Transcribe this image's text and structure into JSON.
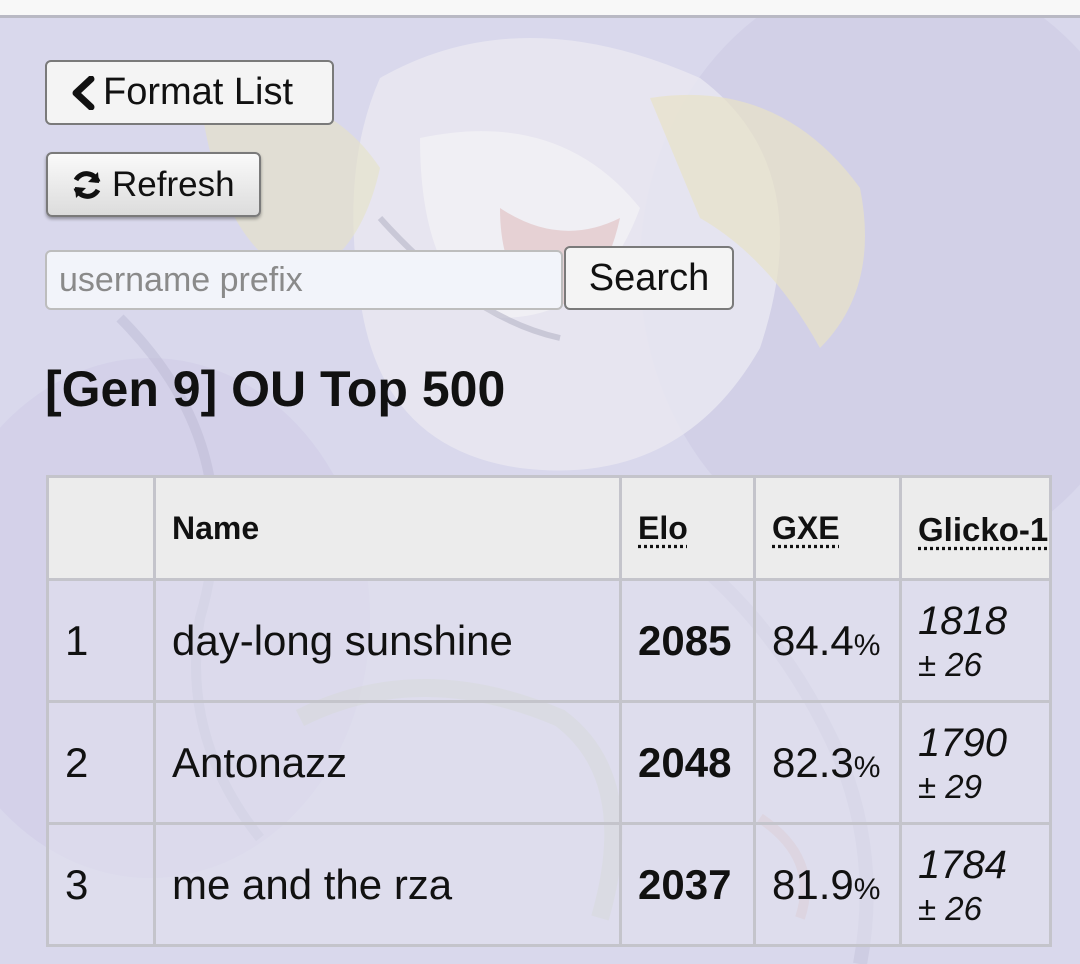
{
  "nav": {
    "back_label": "Format List",
    "refresh_label": "Refresh"
  },
  "search": {
    "placeholder": "username prefix",
    "value": "",
    "button_label": "Search"
  },
  "page_title": "[Gen 9] OU Top 500",
  "table": {
    "headers": {
      "rank": "",
      "name": "Name",
      "elo": "Elo",
      "gxe": "GXE",
      "glicko": "Glicko-1"
    },
    "rows": [
      {
        "rank": "1",
        "name": "day-long sunshine",
        "elo": "2085",
        "gxe": "84.4",
        "gxe_unit": "%",
        "glicko": "1818",
        "glicko_dev": "± 26"
      },
      {
        "rank": "2",
        "name": "Antonazz",
        "elo": "2048",
        "gxe": "82.3",
        "gxe_unit": "%",
        "glicko": "1790",
        "glicko_dev": "± 29"
      },
      {
        "rank": "3",
        "name": "me and the rza",
        "elo": "2037",
        "gxe": "81.9",
        "gxe_unit": "%",
        "glicko": "1784",
        "glicko_dev": "± 26"
      }
    ]
  }
}
